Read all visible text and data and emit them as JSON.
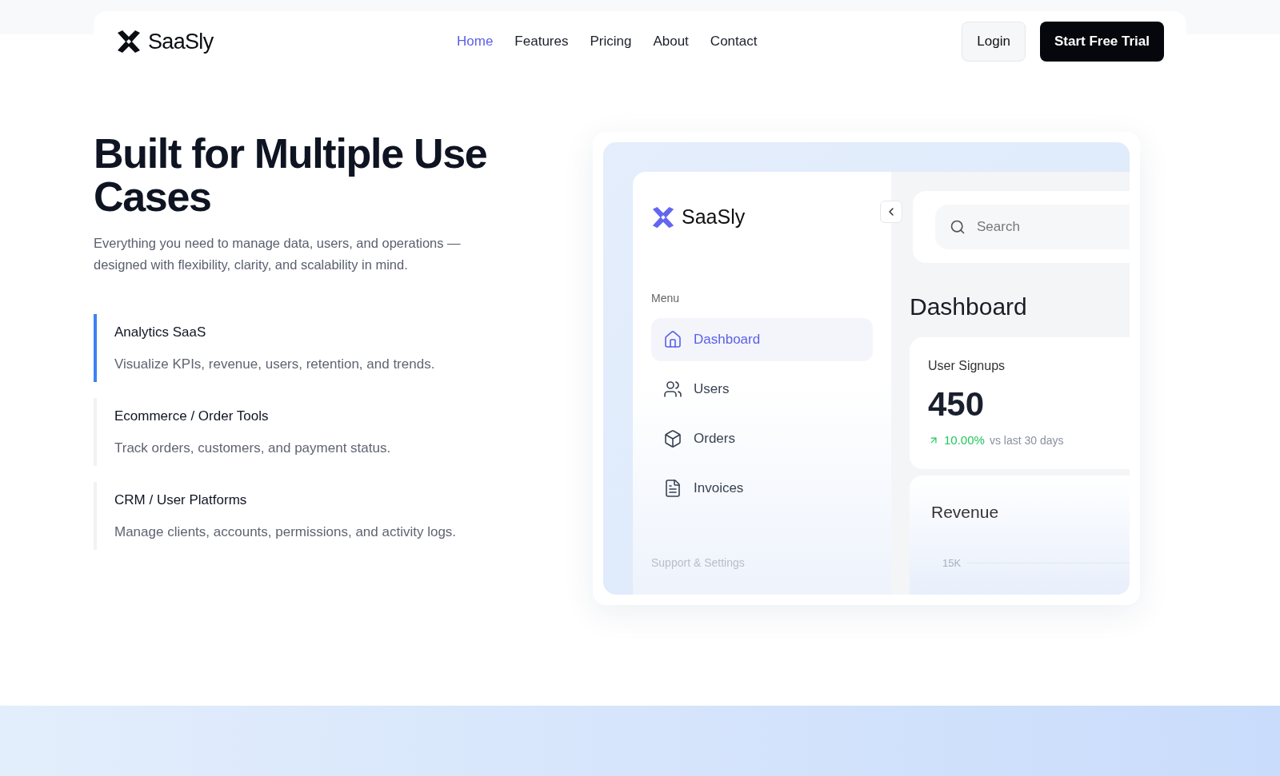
{
  "nav": {
    "logo": "SaaSly",
    "links": [
      {
        "label": "Home",
        "selected": true
      },
      {
        "label": "Features",
        "selected": false
      },
      {
        "label": "Pricing",
        "selected": false
      },
      {
        "label": "About",
        "selected": false
      },
      {
        "label": "Contact",
        "selected": false
      }
    ],
    "login": "Login",
    "cta": "Start Free Trial"
  },
  "hero": {
    "title": "Built for Multiple Use Cases",
    "subtitle": "Everything you need to manage data, users, and operations — designed with flexibility, clarity, and scalability in mind.",
    "use_cases": [
      {
        "title": "Analytics SaaS",
        "description": "Visualize KPIs, revenue, users, retention, and trends.",
        "selected": true
      },
      {
        "title": "Ecommerce / Order Tools",
        "description": "Track orders, customers, and payment status.",
        "selected": false
      },
      {
        "title": "CRM / User Platforms",
        "description": "Manage clients, accounts, permissions, and activity logs.",
        "selected": false
      }
    ]
  },
  "mockup": {
    "logo": "SaaSly",
    "menu_label": "Menu",
    "menu": [
      {
        "label": "Dashboard",
        "kind": "home",
        "selected": true
      },
      {
        "label": "Users",
        "kind": "users",
        "selected": false
      },
      {
        "label": "Orders",
        "kind": "box",
        "selected": false
      },
      {
        "label": "Invoices",
        "kind": "list",
        "selected": false
      }
    ],
    "support_label": "Support & Settings",
    "search": {
      "placeholder": "Search"
    },
    "page_title": "Dashboard",
    "stat": {
      "label": "User Signups",
      "value": "450",
      "change": "10.00%",
      "comparison": "vs last 30 days"
    },
    "revenue": {
      "title": "Revenue",
      "tick": "15K"
    }
  }
}
